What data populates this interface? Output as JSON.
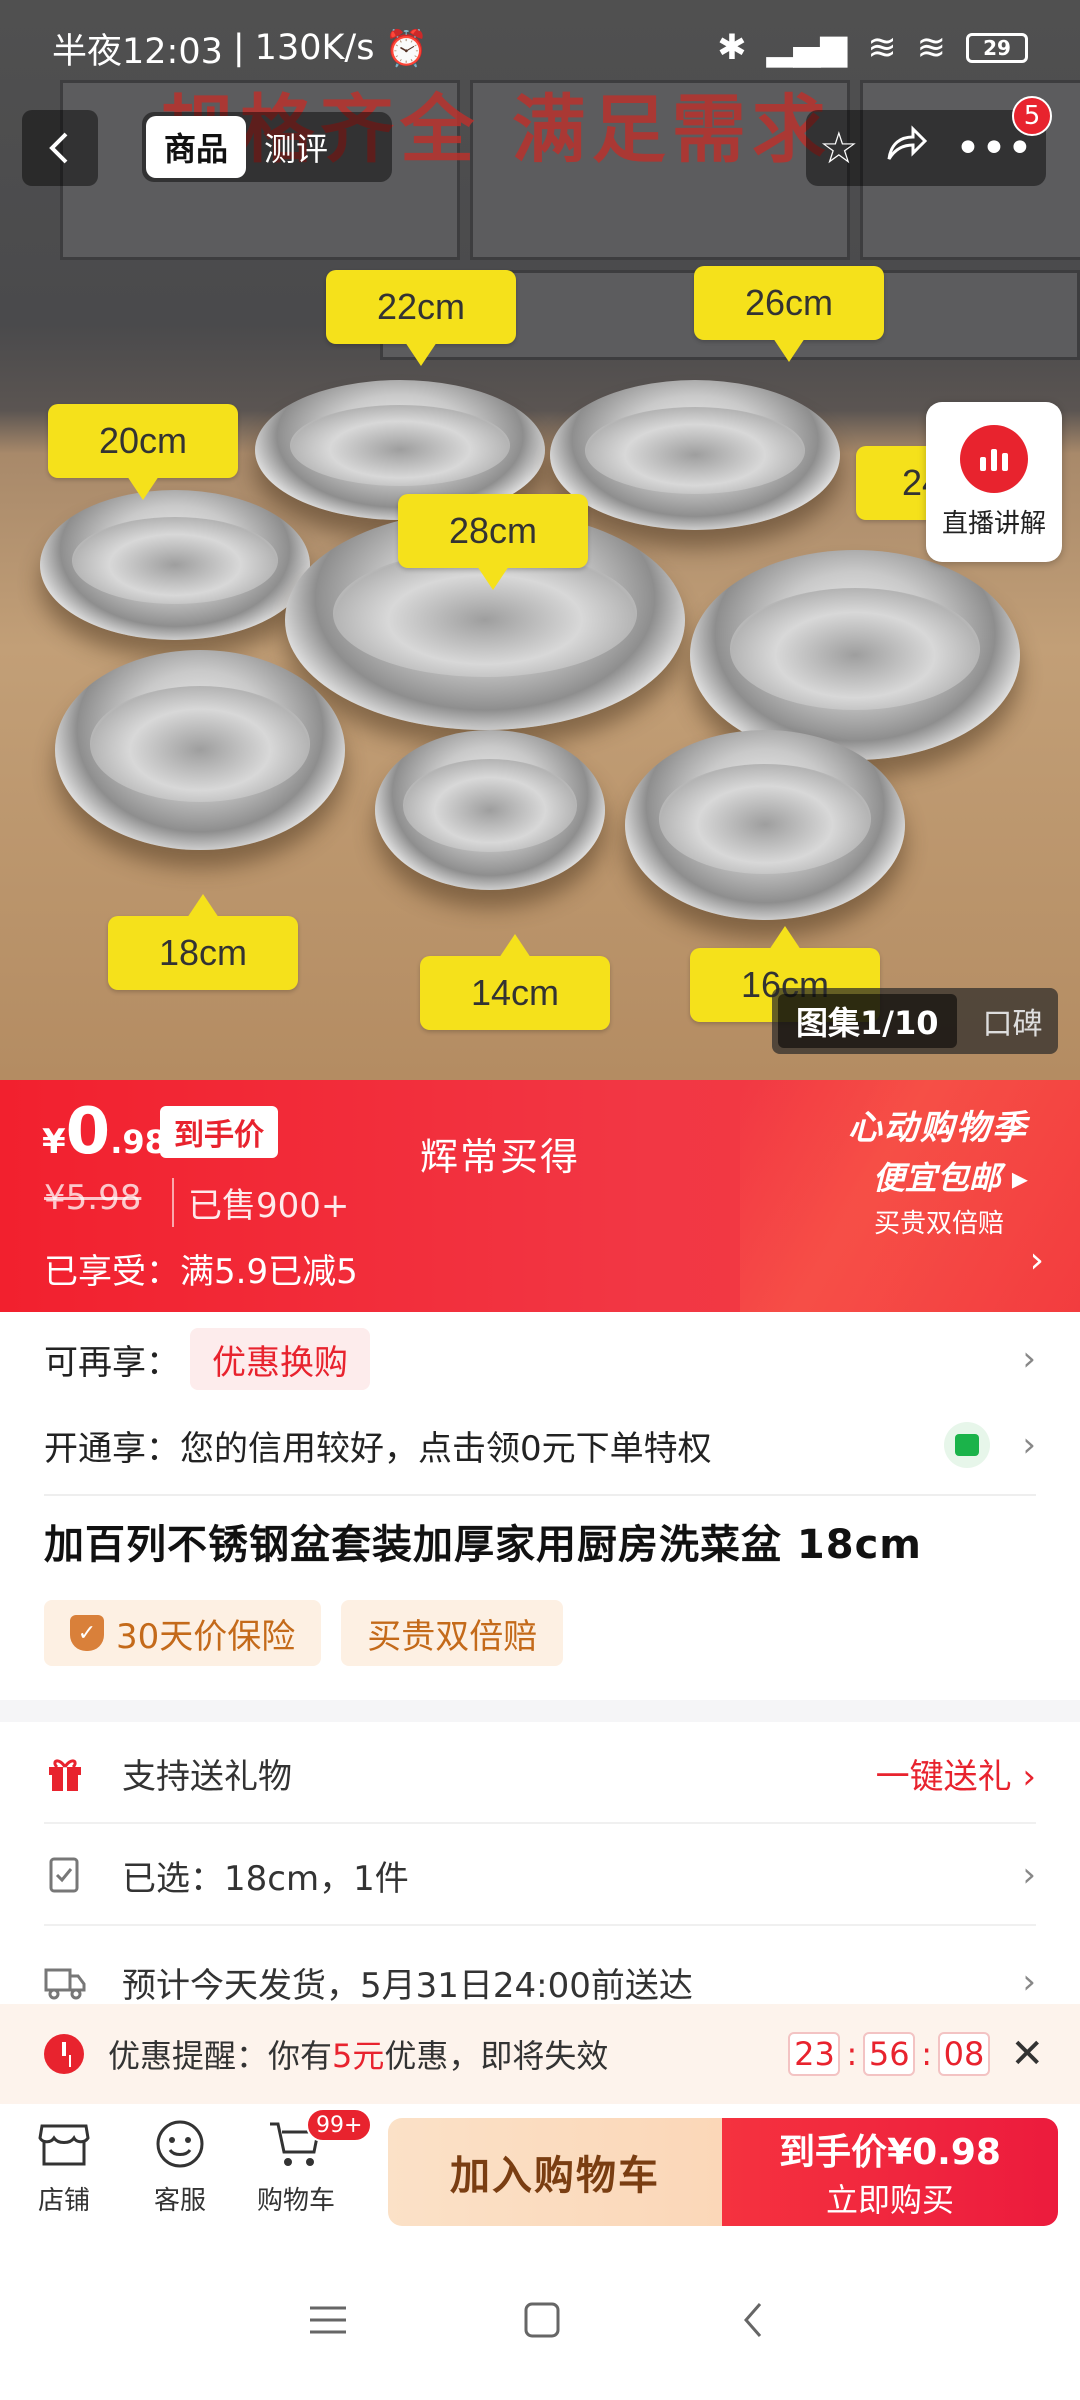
{
  "status": {
    "time": "半夜12:03",
    "speed": "130K/s",
    "battery": "29"
  },
  "nav": {
    "tabs": [
      {
        "label": "商品"
      },
      {
        "label": "测评"
      }
    ],
    "notify_count": "5"
  },
  "photo": {
    "headline": "规格齐全 满足需求",
    "sizes": [
      "22cm",
      "26cm",
      "20cm",
      "24cm",
      "28cm",
      "18cm",
      "14cm",
      "16cm"
    ],
    "live_label": "直播讲解",
    "gallery_label": "图集1/10",
    "reviews_label": "口碑"
  },
  "price": {
    "currency": "¥",
    "integer": "0",
    "decimal": ".98",
    "tag": "到手价",
    "slogan": "辉常买得",
    "original": "¥5.98",
    "sold": "已售900+",
    "enjoyed": "已享受：满5.9已减5",
    "promo_line1": "心动购物季",
    "promo_line2": "便宜包邮 ▸",
    "promo_line3": "买贵双倍赔"
  },
  "extra": {
    "label": "可再享：",
    "chip": "优惠换购"
  },
  "credit": {
    "text": "开通享：您的信用较好，点击领0元下单特权"
  },
  "product": {
    "title": "加百列不锈钢盆套装加厚家用厨房洗菜盆 18cm",
    "badges": [
      "30天价保险",
      "买贵双倍赔"
    ]
  },
  "rows": {
    "gift_label": "支持送礼物",
    "gift_action": "一键送礼 ›",
    "chosen": "已选：18cm，1件",
    "shipping": "预计今天发货，5月31日24:00前送达"
  },
  "reminder": {
    "prefix": "优惠提醒：你有",
    "amount": "5元",
    "suffix": "优惠，即将失效",
    "hh": "23",
    "mm": "56",
    "ss": "08"
  },
  "bottom": {
    "shop": "店铺",
    "service": "客服",
    "cart": "购物车",
    "cart_badge": "99+",
    "add_cart": "加入购物车",
    "buy_label": "到手价",
    "buy_price": "¥0.98",
    "buy_now": "立即购买"
  },
  "colors": {
    "accent": "#e8232e",
    "badge_bg": "#fdf0e3",
    "tag_yellow": "#f5e11b"
  }
}
